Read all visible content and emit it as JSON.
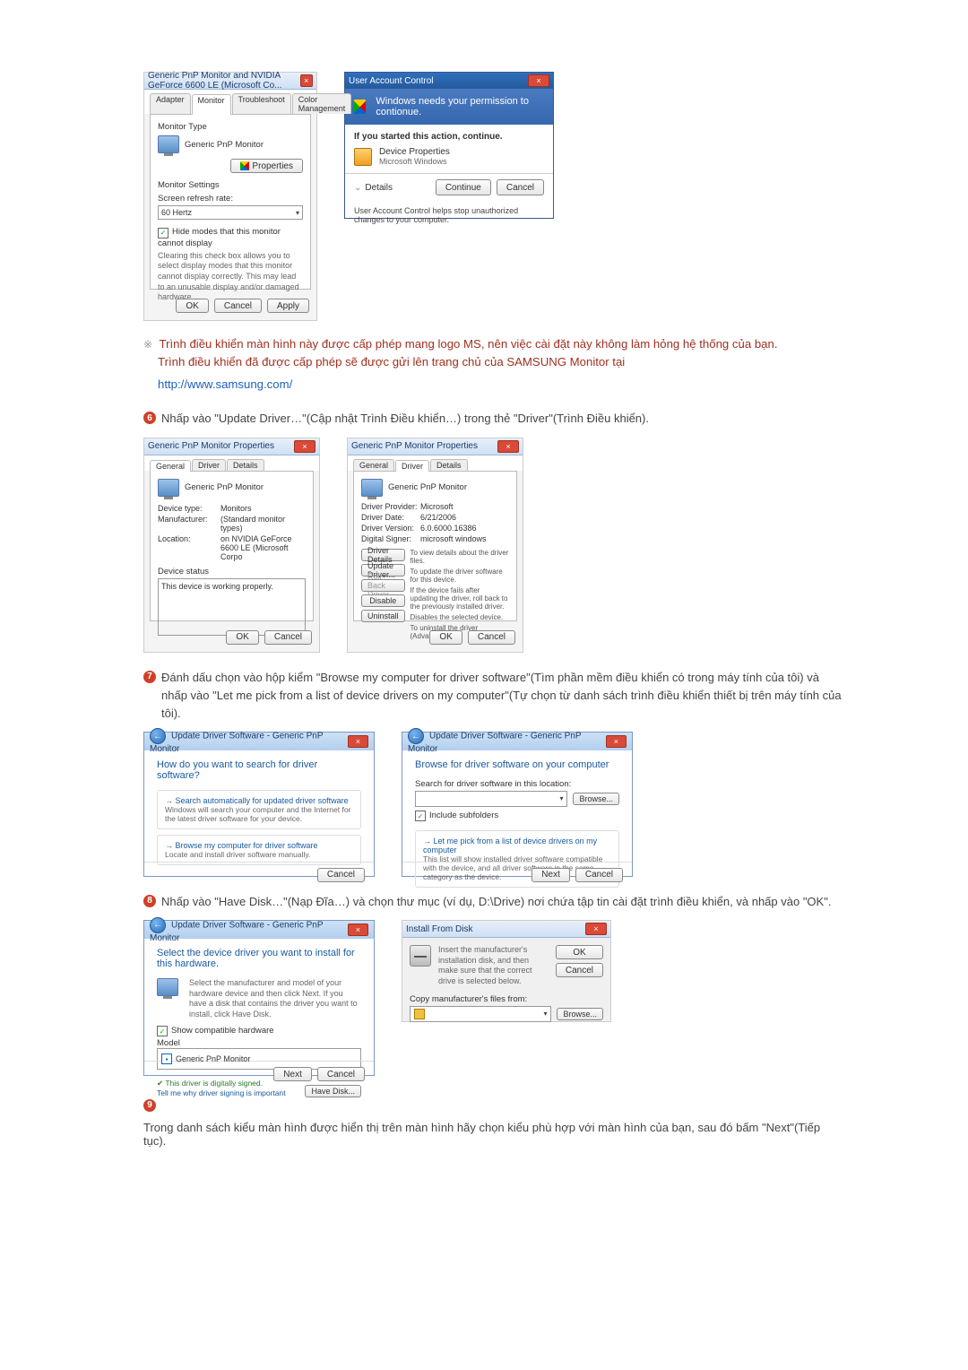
{
  "topLeftDialog": {
    "title": "Generic PnP Monitor and NVIDIA GeForce 6600 LE (Microsoft Co...",
    "tabs": [
      "Adapter",
      "Monitor",
      "Troubleshoot",
      "Color Management"
    ],
    "activeTab": "Monitor",
    "monitorTypeLabel": "Monitor Type",
    "monitorType": "Generic PnP Monitor",
    "propertiesBtn": "Properties",
    "settingsLabel": "Monitor Settings",
    "refreshLabel": "Screen refresh rate:",
    "refreshValue": "60 Hertz",
    "hideModes": "Hide modes that this monitor cannot display",
    "hideDesc": "Clearing this check box allows you to select display modes that this monitor cannot display correctly. This may lead to an unusable display and/or damaged hardware.",
    "ok": "OK",
    "cancel": "Cancel",
    "apply": "Apply"
  },
  "uac": {
    "title": "User Account Control",
    "bannerText": "Windows needs your permission to contionue.",
    "ifYou": "If you started this action, continue.",
    "program": "Device Properties",
    "publisher": "Microsoft Windows",
    "details": "Details",
    "continue": "Continue",
    "cancel": "Cancel",
    "note": "User Account Control helps stop unauthorized changes to your computer."
  },
  "note1": {
    "line1": "Trình điều khiển màn hình này được cấp phép mang logo MS, nên việc cài đặt này không làm hỏng hệ thống của bạn.",
    "line2": "Trình điều khiển đã được cấp phép sẽ được gửi lên trang chủ của SAMSUNG Monitor tại",
    "url": "http://www.samsung.com/"
  },
  "step6": {
    "num": "6",
    "text": "Nhấp vào \"Update Driver…\"(Cập nhật Trình Điều khiển…) trong thẻ \"Driver\"(Trình Điều khiển)."
  },
  "propsGeneral": {
    "title": "Generic PnP Monitor Properties",
    "tabs": [
      "General",
      "Driver",
      "Details"
    ],
    "active": "General",
    "name": "Generic PnP Monitor",
    "deviceType": "Monitors",
    "manufacturer": "(Standard monitor types)",
    "location": "on NVIDIA GeForce 6600 LE (Microsoft Corpo",
    "statusLabel": "Device status",
    "status": "This device is working properly.",
    "deviceTypeLabel": "Device type:",
    "manufacturerLabel": "Manufacturer:",
    "locationLabel": "Location:",
    "ok": "OK",
    "cancel": "Cancel"
  },
  "propsDriver": {
    "title": "Generic PnP Monitor Properties",
    "tabs": [
      "General",
      "Driver",
      "Details"
    ],
    "active": "Driver",
    "name": "Generic PnP Monitor",
    "providerLabel": "Driver Provider:",
    "provider": "Microsoft",
    "dateLabel": "Driver Date:",
    "date": "6/21/2006",
    "versionLabel": "Driver Version:",
    "version": "6.0.6000.16386",
    "signerLabel": "Digital Signer:",
    "signer": "microsoft windows",
    "btnDetails": "Driver Details",
    "descDetails": "To view details about the driver files.",
    "btnUpdate": "Update Driver...",
    "descUpdate": "To update the driver software for this device.",
    "btnRollback": "Roll Back Driver",
    "descRollback": "If the device fails after updating the driver, roll back to the previously installed driver.",
    "btnDisable": "Disable",
    "descDisable": "Disables the selected device.",
    "btnUninstall": "Uninstall",
    "descUninstall": "To uninstall the driver (Advanced).",
    "ok": "OK",
    "cancel": "Cancel"
  },
  "step7": {
    "num": "7",
    "text": "Đánh dấu chọn vào hộp kiểm \"Browse my computer for driver software\"(Tìm phần mềm điều khiển có trong máy tính của tôi) và nhấp vào \"Let me pick from a list of device drivers on my computer\"(Tự chọn từ danh sách trình điều khiển thiết bị trên máy tính của tôi)."
  },
  "wizSearch": {
    "crumb": "Update Driver Software - Generic PnP Monitor",
    "heading": "How do you want to search for driver software?",
    "opt1t": "Search automatically for updated driver software",
    "opt1d": "Windows will search your computer and the Internet for the latest driver software for your device.",
    "opt2t": "Browse my computer for driver software",
    "opt2d": "Locate and install driver software manually.",
    "cancel": "Cancel"
  },
  "wizBrowse": {
    "crumb": "Update Driver Software - Generic PnP Monitor",
    "heading": "Browse for driver software on your computer",
    "searchLabel": "Search for driver software in this location:",
    "browse": "Browse...",
    "includeSub": "Include subfolders",
    "opt3t": "Let me pick from a list of device drivers on my computer",
    "opt3d": "This list will show installed driver software compatible with the device, and all driver software in the same category as the device.",
    "next": "Next",
    "cancel": "Cancel"
  },
  "step8": {
    "num": "8",
    "text": "Nhấp vào \"Have Disk…\"(Nạp Đĩa…) và chọn thư mục (ví dụ, D:\\Drive) nơi chứa tập tin cài đặt trình điều khiển, và nhấp vào \"OK\"."
  },
  "wizSelect": {
    "crumb": "Update Driver Software - Generic PnP Monitor",
    "heading": "Select the device driver you want to install for this hardware.",
    "desc": "Select the manufacturer and model of your hardware device and then click Next. If you have a disk that contains the driver you want to install, click Have Disk.",
    "showCompat": "Show compatible hardware",
    "modelLabel": "Model",
    "model": "Generic PnP Monitor",
    "signed": "This driver is digitally signed.",
    "tellWhy": "Tell me why driver signing is important",
    "haveDisk": "Have Disk...",
    "next": "Next",
    "cancel": "Cancel"
  },
  "installDisk": {
    "title": "Install From Disk",
    "msg": "Insert the manufacturer's installation disk, and then make sure that the correct drive is selected below.",
    "ok": "OK",
    "cancel": "Cancel",
    "copyLabel": "Copy manufacturer's files from:",
    "browse": "Browse..."
  },
  "step9": {
    "num": "9",
    "text": "Trong danh sách kiểu màn hình được hiển thị trên màn hình hãy chọn kiểu phù hợp với màn hình của bạn, sau đó bấm \"Next\"(Tiếp tục)."
  }
}
